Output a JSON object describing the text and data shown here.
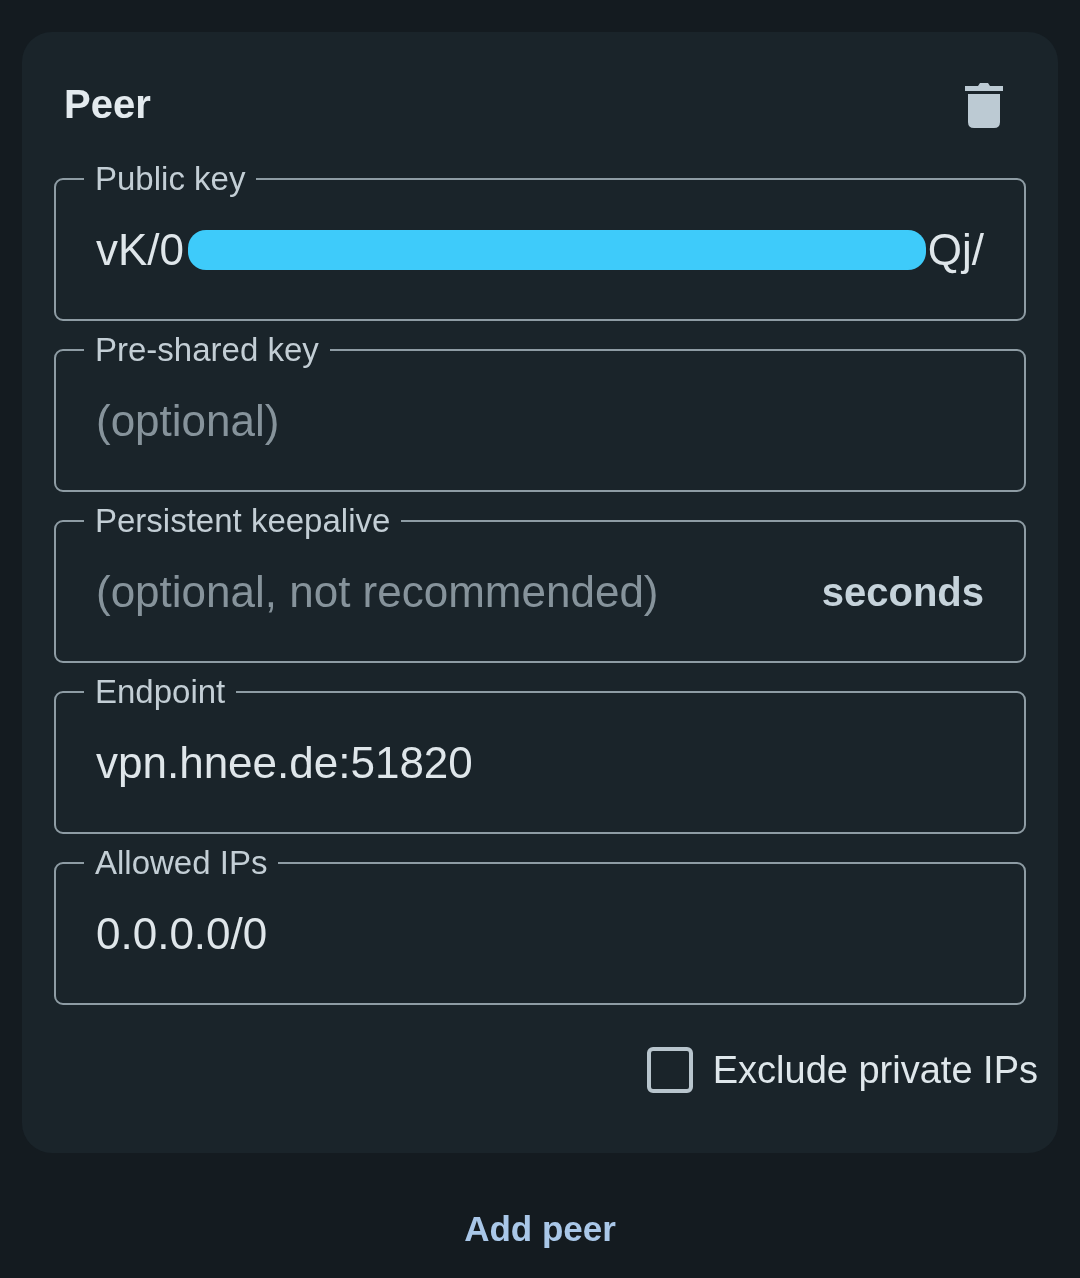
{
  "peer_card": {
    "title": "Peer",
    "fields": [
      {
        "kind": "redacted",
        "label": "Public key",
        "value_parts": [
          "vK/0",
          "Qj/"
        ]
      },
      {
        "kind": "text",
        "label": "Pre-shared key",
        "placeholder": "(optional)"
      },
      {
        "kind": "text",
        "label": "Persistent keepalive",
        "placeholder": "(optional, not recommended)",
        "suffix": "seconds"
      },
      {
        "kind": "text",
        "label": "Endpoint",
        "value": "vpn.hnee.de:51820"
      },
      {
        "kind": "text",
        "label": "Allowed IPs",
        "value": "0.0.0.0/0"
      }
    ],
    "exclude_private_ips": {
      "label": "Exclude private IPs",
      "checked": false
    }
  },
  "add_peer_button": {
    "label": "Add peer"
  }
}
